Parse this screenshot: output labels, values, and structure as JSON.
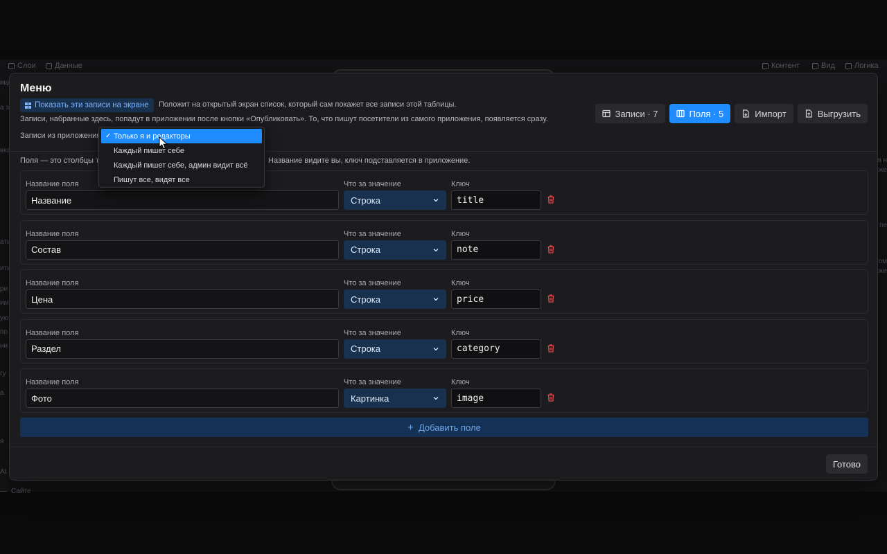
{
  "background": {
    "tabs_left": [
      "Слои",
      "Данные"
    ],
    "tabs_right": [
      "Контент",
      "Вид",
      "Логика"
    ],
    "left_fragments": [
      "ица",
      "а з",
      "вка",
      "ать",
      "ить",
      "ри",
      "им",
      "ую",
      "по",
      "ни",
      "гу",
      "а",
      "я",
      "At",
      "—"
    ],
    "right_fragments": [
      "а н",
      "кже",
      "пе",
      "ом",
      "кже"
    ],
    "bottom_fragment": "Сайте"
  },
  "dialog": {
    "title": "Меню",
    "show_button": "Показать эти записи на экране",
    "show_desc": "Положит на открытый экран список, который сам покажет все записи этой таблицы.",
    "info": "Записи, набранные здесь, попадут в приложении после кнопки «Опубликовать». То, что пишут посетители из самого приложения, появляется сразу.",
    "perm_label": "Записи из приложения",
    "tabs": [
      {
        "label": "Записи · 7",
        "icon": "table-icon",
        "active": false
      },
      {
        "label": "Поля · 5",
        "icon": "columns-icon",
        "active": true
      },
      {
        "label": "Импорт",
        "icon": "file-import-icon",
        "active": false
      },
      {
        "label": "Выгрузить",
        "icon": "file-export-icon",
        "active": false
      }
    ],
    "fields_hint_start": "Поля — это столбцы та",
    "fields_hint_end": "Название видите вы, ключ подставляется в приложение.",
    "field_labels": {
      "name": "Название поля",
      "type": "Что за значение",
      "key": "Ключ"
    },
    "fields": [
      {
        "name": "Название",
        "type": "Строка",
        "key": "title"
      },
      {
        "name": "Состав",
        "type": "Строка",
        "key": "note"
      },
      {
        "name": "Цена",
        "type": "Строка",
        "key": "price"
      },
      {
        "name": "Раздел",
        "type": "Строка",
        "key": "category"
      },
      {
        "name": "Фото",
        "type": "Картинка",
        "key": "image"
      }
    ],
    "add_field": "Добавить поле",
    "done": "Готово"
  },
  "dropdown": {
    "options": [
      "Только я и редакторы",
      "Каждый пишет себе",
      "Каждый пишет себе, админ видит всё",
      "Пишут все, видят все"
    ],
    "selected_index": 0,
    "check": "✓"
  },
  "colors": {
    "accent": "#1f8cff",
    "select_bg": "#18314f",
    "danger": "#e5484d"
  }
}
